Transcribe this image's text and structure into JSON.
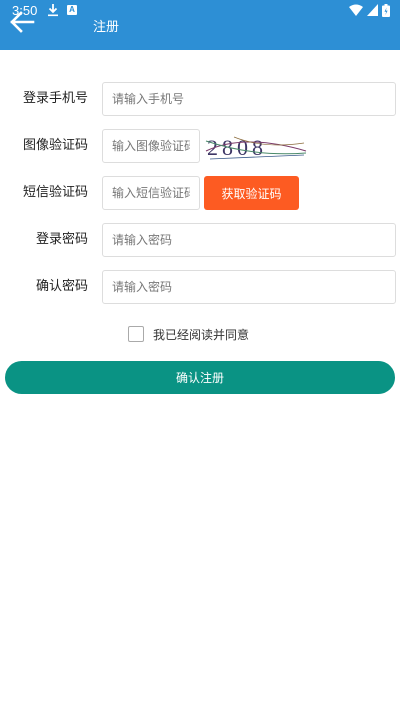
{
  "status_bar": {
    "time": "3:50"
  },
  "header": {
    "title": "注册"
  },
  "form": {
    "phone": {
      "label": "登录手机号",
      "placeholder": "请输入手机号"
    },
    "image_code": {
      "label": "图像验证码",
      "placeholder": "输入图像验证码",
      "captcha_text": "2808"
    },
    "sms_code": {
      "label": "短信验证码",
      "placeholder": "输入短信验证码",
      "button_label": "获取验证码"
    },
    "password": {
      "label": "登录密码",
      "placeholder": "请输入密码"
    },
    "confirm_password": {
      "label": "确认密码",
      "placeholder": "请输入密码"
    }
  },
  "agreement": {
    "text": "我已经阅读并同意",
    "checked": false
  },
  "submit": {
    "label": "确认注册"
  },
  "colors": {
    "header": "#2d8fd5",
    "sms_button": "#fd5b22",
    "submit_button": "#0a9384"
  }
}
